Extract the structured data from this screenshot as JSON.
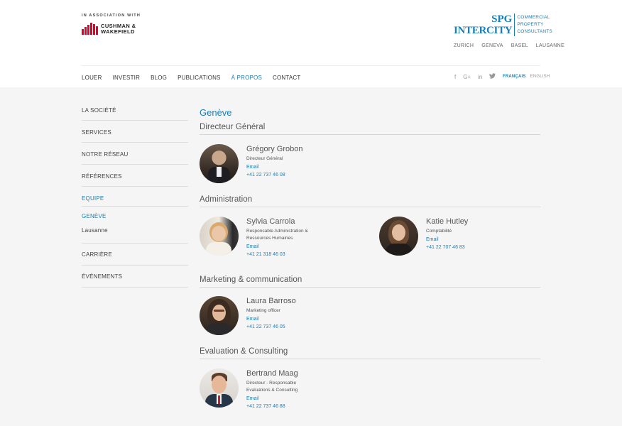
{
  "header": {
    "association": "IN ASSOCIATION WITH",
    "partner_line1": "CUSHMAN &",
    "partner_line2": "WAKEFIELD",
    "brand_line1": "SPG",
    "brand_line2": "INTERCITY",
    "brand_sub1": "COMMERCIAL",
    "brand_sub2": "PROPERTY",
    "brand_sub3": "CONSULTANTS",
    "cities": [
      "ZURICH",
      "GENEVA",
      "BASEL",
      "LAUSANNE"
    ]
  },
  "nav": {
    "items": [
      "LOUER",
      "INVESTIR",
      "BLOG",
      "PUBLICATIONS",
      "À PROPOS",
      "CONTACT"
    ],
    "active": "À PROPOS"
  },
  "social": {
    "facebook": "f",
    "google": "G+",
    "linkedin": "in",
    "twitter": "🐦"
  },
  "languages": {
    "current": "FRANÇAIS",
    "other": "ENGLISH"
  },
  "sidebar": {
    "items": [
      "LA SOCIÉTÉ",
      "SERVICES",
      "NOTRE RÉSEAU",
      "RÉFÉRENCES",
      "EQUIPE",
      "CARRIÈRE",
      "ÉVÉNEMENTS"
    ],
    "sub_active": "GENÈVE",
    "sub_other": "Lausanne"
  },
  "main": {
    "city_title": "Genève",
    "sections": [
      {
        "title": "Directeur Général",
        "people": [
          {
            "name": "Grégory Grobon",
            "role_line1": "Directeur Général",
            "role_line2": "",
            "email": "Email",
            "phone": "+41 22 737 46 08"
          }
        ]
      },
      {
        "title": "Administration",
        "people": [
          {
            "name": "Sylvia Carrola",
            "role_line1": "Responsable Administration &",
            "role_line2": "Ressources Humaines",
            "email": "Email",
            "phone": "+41 21 318 46 03"
          },
          {
            "name": "Katie Hutley",
            "role_line1": "Comptabilité",
            "role_line2": "",
            "email": "Email",
            "phone": "+41 22 707 46 83"
          }
        ]
      },
      {
        "title": "Marketing & communication",
        "people": [
          {
            "name": "Laura Barroso",
            "role_line1": "Marketing officer",
            "role_line2": "",
            "email": "Email",
            "phone": "+41 22 737 46 05"
          }
        ]
      },
      {
        "title": "Evaluation & Consulting",
        "people": [
          {
            "name": "Bertrand Maag",
            "role_line1": "Directeur - Responsable",
            "role_line2": "Evaluations & Consulting",
            "email": "Email",
            "phone": "+41 22 737 46 88"
          }
        ]
      }
    ]
  },
  "colors": {
    "accent": "#1a7fb8",
    "brand_red": "#e4002b",
    "background": "#f5f5f5"
  }
}
